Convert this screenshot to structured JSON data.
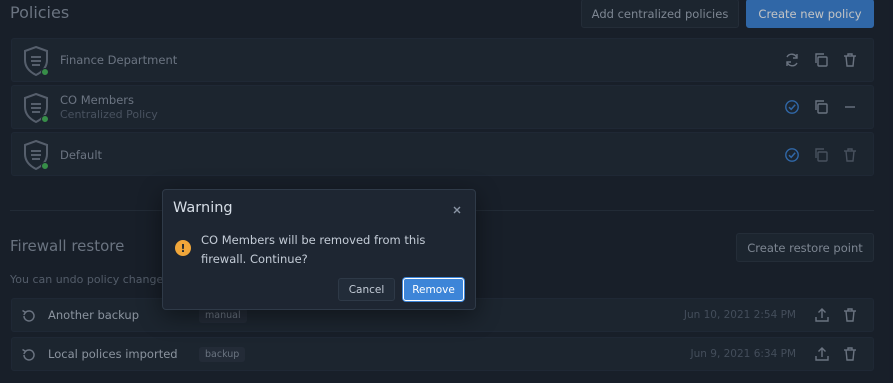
{
  "header": {
    "title": "Policies",
    "add_centralized_label": "Add centralized policies",
    "create_new_label": "Create new policy"
  },
  "policies": [
    {
      "name": "Finance Department",
      "subtitle": "",
      "actions": [
        "refresh-icon",
        "copy-icon",
        "trash-icon"
      ]
    },
    {
      "name": "CO Members",
      "subtitle": "Centralized Policy",
      "actions": [
        "check-circle-icon",
        "copy-icon",
        "minus-icon"
      ]
    },
    {
      "name": "Default",
      "subtitle": "",
      "actions": [
        "check-circle-icon",
        "copy-icon",
        "trash-icon"
      ]
    }
  ],
  "firewall_restore": {
    "title": "Firewall restore",
    "create_restore_label": "Create restore point",
    "description": "You can undo policy change",
    "backups": [
      {
        "name": "Another backup",
        "tag": "manual",
        "date": "Jun 10, 2021 2:54 PM"
      },
      {
        "name": "Local polices imported",
        "tag": "backup",
        "date": "Jun 9, 2021 6:34 PM"
      }
    ]
  },
  "modal": {
    "title": "Warning",
    "message": "CO Members will be removed from this firewall. Continue?",
    "cancel_label": "Cancel",
    "remove_label": "Remove"
  },
  "colors": {
    "background": "#1c2430",
    "card": "#222c39",
    "primary": "#3d85d8",
    "status_ok": "#46b85a",
    "warning": "#f0a63a"
  }
}
